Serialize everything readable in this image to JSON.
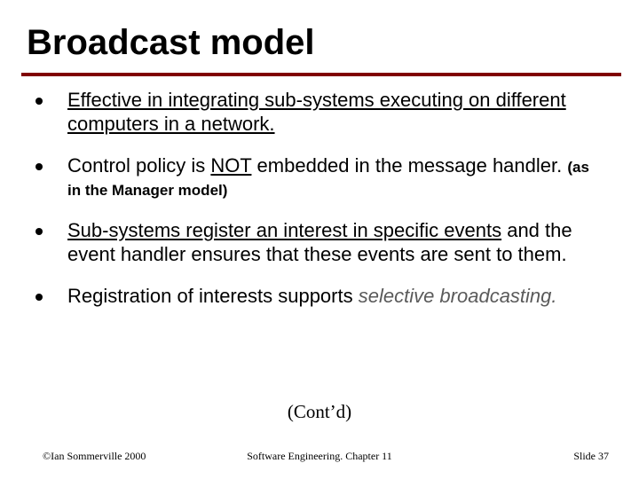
{
  "title": "Broadcast model",
  "bullets": {
    "b1_u": "Effective in integrating sub-systems executing on different computers in a network.",
    "b2_pre": "Control policy is ",
    "b2_not": "NOT",
    "b2_post": " embedded in the message handler.  ",
    "b2_small": "(as in the Manager model)",
    "b3_u": "Sub-systems register an interest in specific events",
    "b3_rest": " and the event handler ensures that these events are sent to them.",
    "b4_pre": "Registration of interests supports ",
    "b4_it": "selective broadcasting.",
    "contd": "(Cont’d)"
  },
  "footer": {
    "left": "©Ian Sommerville 2000",
    "center": "Software Engineering. Chapter 11",
    "right": "Slide 37"
  }
}
